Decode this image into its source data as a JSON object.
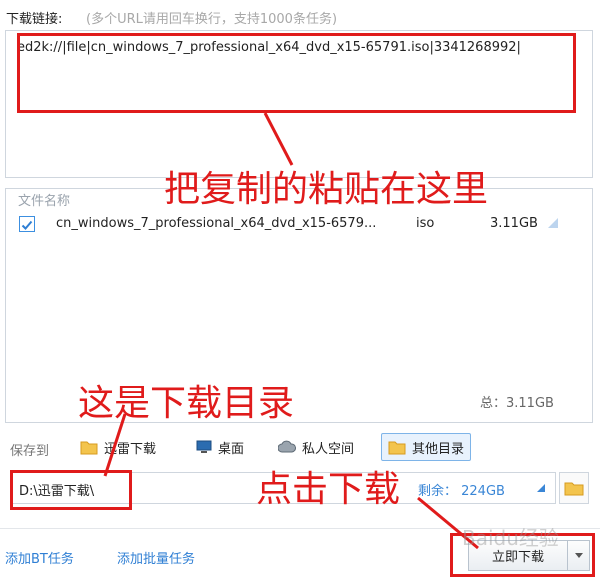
{
  "url_section": {
    "label": "下载链接:",
    "hint": "(多个URL请用回车换行，支持1000条任务)",
    "value": "ed2k://|file|cn_windows_7_professional_x64_dvd_x15-65791.iso|3341268992|"
  },
  "file_list": {
    "column_name": "文件名称",
    "rows": [
      {
        "name": "cn_windows_7_professional_x64_dvd_x15-6579...",
        "type": "iso",
        "size": "3.11GB",
        "checked": true
      }
    ],
    "total": "总：3.11GB"
  },
  "save": {
    "label": "保存到",
    "destinations": [
      "迅雷下载",
      "桌面",
      "私人空间",
      "其他目录"
    ],
    "selected": "其他目录",
    "path": "D:\\迅雷下载\\",
    "remaining": "剩余：  224GB"
  },
  "footer": {
    "add_bt": "添加BT任务",
    "add_batch": "添加批量任务",
    "download_now": "立即下载"
  },
  "annotations": {
    "paste_here": "把复制的粘贴在这里",
    "download_dir": "这是下载目录",
    "click_download": "点击下载"
  },
  "watermark": "Baidu经验",
  "colors": {
    "annotation": "#e01b1b",
    "link": "#2f7fd4",
    "accent": "#3c8fe0"
  }
}
